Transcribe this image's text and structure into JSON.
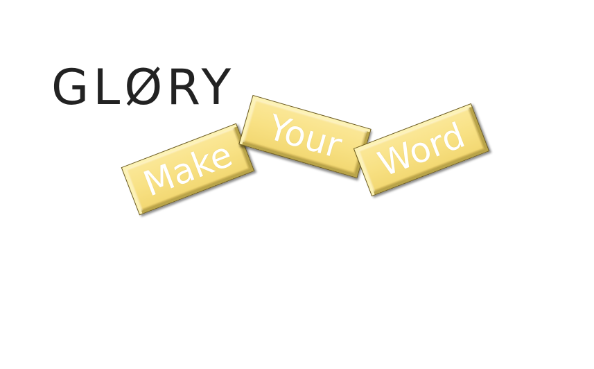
{
  "logo": {
    "text": "GLØRY"
  },
  "tiles": [
    {
      "label": "Make"
    },
    {
      "label": "Your"
    },
    {
      "label": "Word"
    }
  ],
  "colors": {
    "background": "#ffffff",
    "logo": "#222222",
    "tile_fill": "#f8e184",
    "tile_border": "#6b5a1c",
    "tile_text": "#ffffff"
  }
}
